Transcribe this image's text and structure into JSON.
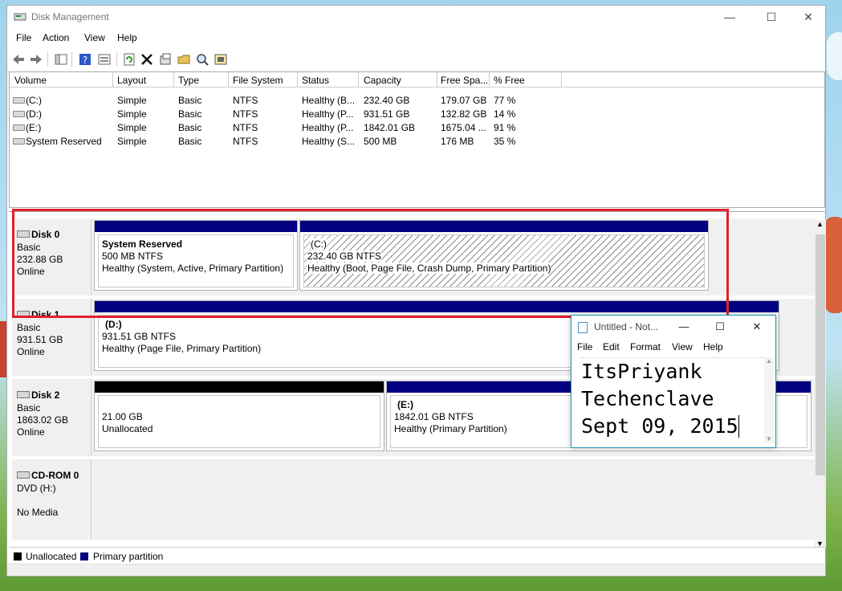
{
  "window": {
    "title": "Disk Management",
    "minimize": "—",
    "maximize": "☐",
    "close": "✕"
  },
  "menu": [
    "File",
    "Action",
    "View",
    "Help"
  ],
  "toolbar": {
    "icons": [
      "back-arrow-icon",
      "forward-arrow-icon",
      "console-tree-icon",
      "help-icon",
      "properties-view-icon",
      "refresh-icon",
      "delete-icon",
      "properties-icon",
      "open-icon",
      "search-icon",
      "settings-icon"
    ]
  },
  "volumes": {
    "columns": [
      "Volume",
      "Layout",
      "Type",
      "File System",
      "Status",
      "Capacity",
      "Free Spa...",
      "% Free"
    ],
    "rows": [
      [
        "(C:)",
        "Simple",
        "Basic",
        "NTFS",
        "Healthy (B...",
        "232.40 GB",
        "179.07 GB",
        "77 %"
      ],
      [
        "(D:)",
        "Simple",
        "Basic",
        "NTFS",
        "Healthy (P...",
        "931.51 GB",
        "132.82 GB",
        "14 %"
      ],
      [
        "(E:)",
        "Simple",
        "Basic",
        "NTFS",
        "Healthy (P...",
        "1842.01 GB",
        "1675.04 ...",
        "91 %"
      ],
      [
        "System Reserved",
        "Simple",
        "Basic",
        "NTFS",
        "Healthy (S...",
        "500 MB",
        "176 MB",
        "35 %"
      ]
    ]
  },
  "disks": {
    "disk0": {
      "name": "Disk 0",
      "kind": "Basic",
      "size": "232.88 GB",
      "state": "Online",
      "p1": {
        "title": "System Reserved",
        "line1": "500 MB NTFS",
        "line2": "Healthy (System, Active, Primary Partition)"
      },
      "p2": {
        "title": "(C:)",
        "line1": "232.40 GB NTFS",
        "line2": "Healthy (Boot, Page File, Crash Dump, Primary Partition)"
      }
    },
    "disk1": {
      "name": "Disk 1",
      "kind": "Basic",
      "size": "931.51 GB",
      "state": "Online",
      "p1": {
        "title": "(D:)",
        "line1": "931.51 GB NTFS",
        "line2": "Healthy (Page File, Primary Partition)"
      }
    },
    "disk2": {
      "name": "Disk 2",
      "kind": "Basic",
      "size": "1863.02 GB",
      "state": "Online",
      "p1": {
        "line1": "21.00 GB",
        "line2": "Unallocated"
      },
      "p2": {
        "title": "(E:)",
        "line1": "1842.01 GB NTFS",
        "line2": "Healthy (Primary Partition)"
      }
    },
    "cdrom": {
      "name": "CD-ROM 0",
      "kind": "DVD (H:)",
      "state": "No Media"
    }
  },
  "legend": {
    "unallocated": "Unallocated",
    "primary": "Primary partition"
  },
  "colors": {
    "primary": "#000080",
    "unallocated": "#000000",
    "highlight": "#e0212b",
    "notepad_border": "#1e9bb5"
  },
  "notepad": {
    "title": "Untitled - Not...",
    "menu": [
      "File",
      "Edit",
      "Format",
      "View",
      "Help"
    ],
    "lines": [
      "ItsPriyank",
      "Techenclave",
      "Sept 09, 2015"
    ]
  }
}
